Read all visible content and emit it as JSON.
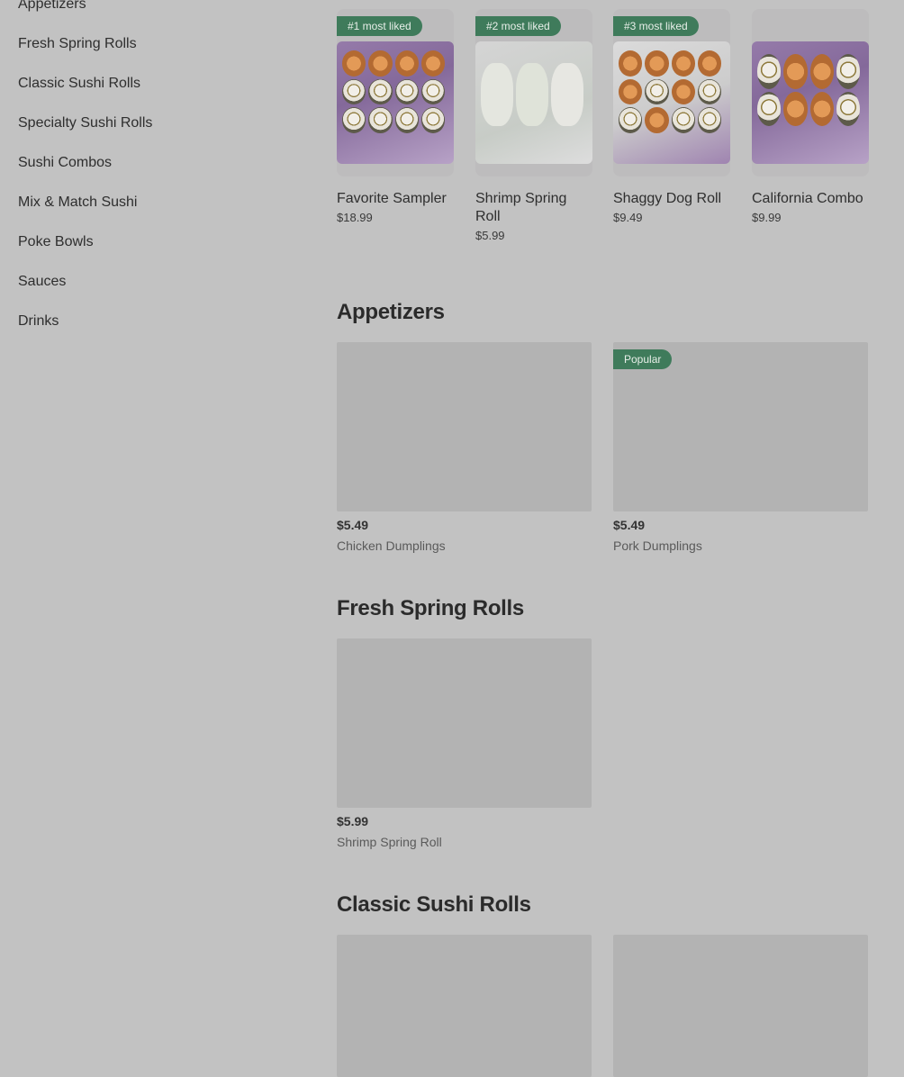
{
  "sidebar": {
    "items": [
      {
        "label": "Appetizers"
      },
      {
        "label": "Fresh Spring Rolls"
      },
      {
        "label": "Classic Sushi Rolls"
      },
      {
        "label": "Specialty Sushi Rolls"
      },
      {
        "label": "Sushi Combos"
      },
      {
        "label": "Mix & Match Sushi"
      },
      {
        "label": "Poke Bowls"
      },
      {
        "label": "Sauces"
      },
      {
        "label": "Drinks"
      }
    ]
  },
  "featured": [
    {
      "badge": "#1 most liked",
      "name": "Favorite Sampler",
      "price": "$18.99"
    },
    {
      "badge": "#2 most liked",
      "name": "Shrimp Spring Roll",
      "price": "$5.99"
    },
    {
      "badge": "#3 most liked",
      "name": "Shaggy Dog Roll",
      "price": "$9.49"
    },
    {
      "badge": "",
      "name": "California Combo",
      "price": "$9.99"
    }
  ],
  "sections": {
    "appetizers": {
      "title": "Appetizers",
      "items": [
        {
          "badge": "",
          "price": "$5.49",
          "name": "Chicken Dumplings"
        },
        {
          "badge": "Popular",
          "price": "$5.49",
          "name": "Pork Dumplings"
        }
      ]
    },
    "spring_rolls": {
      "title": "Fresh Spring Rolls",
      "items": [
        {
          "badge": "",
          "price": "$5.99",
          "name": "Shrimp Spring Roll"
        }
      ]
    },
    "classic_rolls": {
      "title": "Classic Sushi Rolls"
    }
  },
  "colors": {
    "badge": "#3f7b5b",
    "overlay_bg": "#c2c2c2"
  }
}
